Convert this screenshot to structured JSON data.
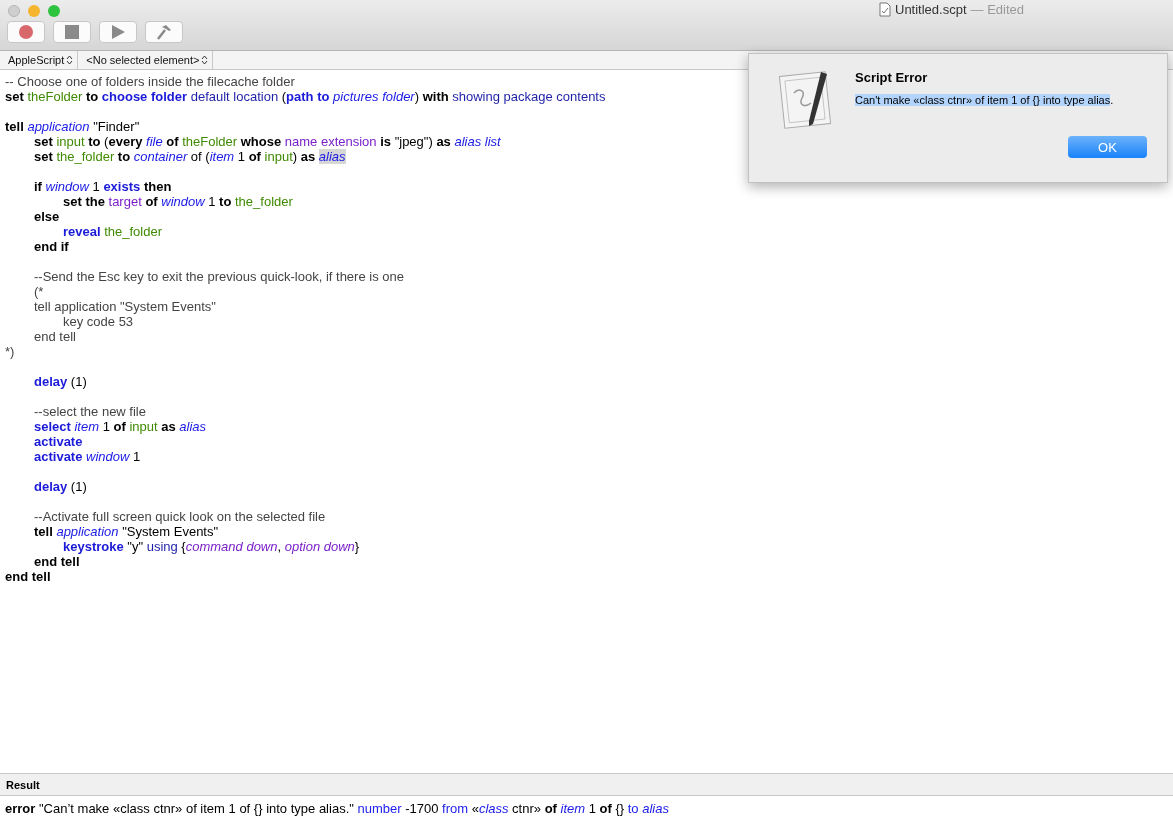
{
  "window": {
    "title": "Untitled.scpt",
    "status": "— Edited"
  },
  "toolbar": [
    {
      "kind": "record"
    },
    {
      "kind": "stop"
    },
    {
      "kind": "run"
    },
    {
      "kind": "compile"
    }
  ],
  "navigation": [
    {
      "label": "AppleScript"
    },
    {
      "label": "<No selected element>"
    }
  ],
  "code": [
    {
      "kind": "code",
      "tokens": [
        {
          "kind": "comment",
          "text": "-- Choose one of folders inside the filecache folder"
        }
      ]
    },
    {
      "kind": "code",
      "tokens": [
        {
          "kind": "kw",
          "text": "set "
        },
        {
          "kind": "var",
          "text": "theFolder"
        },
        {
          "kind": "kw",
          "text": " to "
        },
        {
          "kind": "cmd",
          "text": "choose folder"
        },
        {
          "kind": "param",
          "text": " default location "
        },
        {
          "kind": "plain",
          "text": "("
        },
        {
          "kind": "cmd",
          "text": "path to "
        },
        {
          "kind": "cls",
          "text": "pictures folder"
        },
        {
          "kind": "plain",
          "text": ") "
        },
        {
          "kind": "kw",
          "text": "with"
        },
        {
          "kind": "param",
          "text": " showing package contents"
        }
      ]
    },
    {
      "kind": "blank"
    },
    {
      "kind": "code",
      "tokens": [
        {
          "kind": "kw",
          "text": "tell "
        },
        {
          "kind": "cls",
          "text": "application"
        },
        {
          "kind": "plain",
          "text": " \"Finder\""
        }
      ]
    },
    {
      "kind": "code",
      "tokens": [
        {
          "kind": "kw",
          "text": "\tset "
        },
        {
          "kind": "var",
          "text": "input"
        },
        {
          "kind": "kw",
          "text": " to "
        },
        {
          "kind": "plain",
          "text": "("
        },
        {
          "kind": "kw",
          "text": "every "
        },
        {
          "kind": "cls",
          "text": "file"
        },
        {
          "kind": "kw",
          "text": " of "
        },
        {
          "kind": "var",
          "text": "theFolder"
        },
        {
          "kind": "kw",
          "text": " whose "
        },
        {
          "kind": "prop",
          "text": "name extension"
        },
        {
          "kind": "kw",
          "text": " is "
        },
        {
          "kind": "plain",
          "text": "\"jpeg\") "
        },
        {
          "kind": "kw",
          "text": "as "
        },
        {
          "kind": "cls",
          "text": "alias list"
        }
      ]
    },
    {
      "kind": "code",
      "tokens": [
        {
          "kind": "kw",
          "text": "\tset "
        },
        {
          "kind": "var",
          "text": "the_folder"
        },
        {
          "kind": "kw",
          "text": " to "
        },
        {
          "kind": "cls",
          "text": "container"
        },
        {
          "kind": "plain",
          "text": " of ("
        },
        {
          "kind": "cls",
          "text": "item"
        },
        {
          "kind": "plain",
          "text": " 1 "
        },
        {
          "kind": "kw",
          "text": "of "
        },
        {
          "kind": "var",
          "text": "input"
        },
        {
          "kind": "plain",
          "text": ") "
        },
        {
          "kind": "kw",
          "text": "as "
        },
        {
          "kind": "cls_selected",
          "text": "alias"
        }
      ]
    },
    {
      "kind": "blank"
    },
    {
      "kind": "code",
      "tokens": [
        {
          "kind": "kw",
          "text": "\tif "
        },
        {
          "kind": "cls",
          "text": "window"
        },
        {
          "kind": "plain",
          "text": " 1 "
        },
        {
          "kind": "cmd",
          "text": "exists"
        },
        {
          "kind": "kw",
          "text": " then"
        }
      ]
    },
    {
      "kind": "code",
      "tokens": [
        {
          "kind": "kw",
          "text": "\t\tset the "
        },
        {
          "kind": "prop",
          "text": "target"
        },
        {
          "kind": "kw",
          "text": " of "
        },
        {
          "kind": "cls",
          "text": "window"
        },
        {
          "kind": "plain",
          "text": " 1 "
        },
        {
          "kind": "kw",
          "text": "to "
        },
        {
          "kind": "var",
          "text": "the_folder"
        }
      ]
    },
    {
      "kind": "code",
      "tokens": [
        {
          "kind": "kw",
          "text": "\telse"
        }
      ]
    },
    {
      "kind": "code",
      "tokens": [
        {
          "kind": "cmd",
          "text": "\t\treveal "
        },
        {
          "kind": "var",
          "text": "the_folder"
        }
      ]
    },
    {
      "kind": "code",
      "tokens": [
        {
          "kind": "kw",
          "text": "\tend if"
        }
      ]
    },
    {
      "kind": "blank"
    },
    {
      "kind": "code",
      "tokens": [
        {
          "kind": "comment",
          "text": "\t--Send the Esc key to exit the previous quick-look, if there is one"
        }
      ]
    },
    {
      "kind": "code",
      "tokens": [
        {
          "kind": "comment",
          "text": "\t(*"
        }
      ]
    },
    {
      "kind": "code",
      "tokens": [
        {
          "kind": "comment",
          "text": "\ttell application \"System Events\""
        }
      ]
    },
    {
      "kind": "code",
      "tokens": [
        {
          "kind": "comment",
          "text": "\t\tkey code 53"
        }
      ]
    },
    {
      "kind": "code",
      "tokens": [
        {
          "kind": "comment",
          "text": "\tend tell"
        }
      ]
    },
    {
      "kind": "code",
      "tokens": [
        {
          "kind": "comment",
          "text": "*)"
        }
      ]
    },
    {
      "kind": "blank"
    },
    {
      "kind": "code",
      "tokens": [
        {
          "kind": "cmd",
          "text": "\tdelay"
        },
        {
          "kind": "plain",
          "text": " (1)"
        }
      ]
    },
    {
      "kind": "blank"
    },
    {
      "kind": "code",
      "tokens": [
        {
          "kind": "comment",
          "text": "\t--select the new file"
        }
      ]
    },
    {
      "kind": "code",
      "tokens": [
        {
          "kind": "cmd",
          "text": "\tselect "
        },
        {
          "kind": "cls",
          "text": "item"
        },
        {
          "kind": "plain",
          "text": " 1 "
        },
        {
          "kind": "kw",
          "text": "of "
        },
        {
          "kind": "var",
          "text": "input"
        },
        {
          "kind": "kw",
          "text": " as "
        },
        {
          "kind": "cls",
          "text": "alias"
        }
      ]
    },
    {
      "kind": "code",
      "tokens": [
        {
          "kind": "cmd",
          "text": "\tactivate"
        }
      ]
    },
    {
      "kind": "code",
      "tokens": [
        {
          "kind": "cmd",
          "text": "\tactivate "
        },
        {
          "kind": "cls",
          "text": "window"
        },
        {
          "kind": "plain",
          "text": " 1"
        }
      ]
    },
    {
      "kind": "blank"
    },
    {
      "kind": "code",
      "tokens": [
        {
          "kind": "cmd",
          "text": "\tdelay"
        },
        {
          "kind": "plain",
          "text": " (1)"
        }
      ]
    },
    {
      "kind": "blank"
    },
    {
      "kind": "code",
      "tokens": [
        {
          "kind": "comment",
          "text": "\t--Activate full screen quick look on the selected file"
        }
      ]
    },
    {
      "kind": "code",
      "tokens": [
        {
          "kind": "kw",
          "text": "\ttell "
        },
        {
          "kind": "cls",
          "text": "application"
        },
        {
          "kind": "plain",
          "text": " \"System Events\""
        }
      ]
    },
    {
      "kind": "code",
      "tokens": [
        {
          "kind": "cmd",
          "text": "\t\tkeystroke"
        },
        {
          "kind": "plain",
          "text": " \"y\" "
        },
        {
          "kind": "param",
          "text": "using"
        },
        {
          "kind": "plain",
          "text": " {"
        },
        {
          "kind": "enum",
          "text": "command down"
        },
        {
          "kind": "plain",
          "text": ", "
        },
        {
          "kind": "enum",
          "text": "option down"
        },
        {
          "kind": "plain",
          "text": "}"
        }
      ]
    },
    {
      "kind": "code",
      "tokens": [
        {
          "kind": "kw",
          "text": "\tend tell"
        }
      ]
    },
    {
      "kind": "code",
      "tokens": [
        {
          "kind": "kw",
          "text": "end tell"
        }
      ]
    }
  ],
  "result": {
    "heading": "Result",
    "tokens": [
      {
        "kind": "kw",
        "text": "error"
      },
      {
        "kind": "plain",
        "text": " \"Can’t make «class ctnr» of item 1 of {} into type alias.\" "
      },
      {
        "kind": "param2",
        "text": "number"
      },
      {
        "kind": "plain",
        "text": " -1700 "
      },
      {
        "kind": "param2",
        "text": "from"
      },
      {
        "kind": "plain",
        "text": " «"
      },
      {
        "kind": "cls",
        "text": "class"
      },
      {
        "kind": "plain",
        "text": " ctnr» "
      },
      {
        "kind": "kw",
        "text": "of "
      },
      {
        "kind": "cls",
        "text": "item"
      },
      {
        "kind": "plain",
        "text": " 1 "
      },
      {
        "kind": "kw",
        "text": "of"
      },
      {
        "kind": "plain",
        "text": " {} "
      },
      {
        "kind": "param2",
        "text": "to "
      },
      {
        "kind": "cls",
        "text": "alias"
      }
    ]
  },
  "alert": {
    "title": "Script Error",
    "message_selected": "Can't make «class ctnr» of item 1 of {} into type alias",
    "message_rest": ".",
    "button": "OK"
  }
}
